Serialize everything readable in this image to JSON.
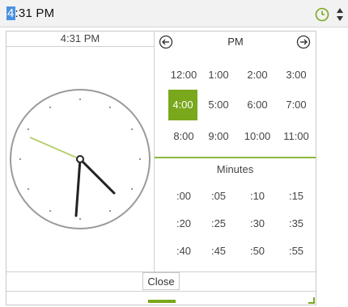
{
  "input": {
    "first_char": "4",
    "rest": ":31 PM"
  },
  "icons": {
    "clock": "clock-icon",
    "spin": "spin-arrows-icon",
    "prev": "arrow-left-circle-icon",
    "next": "arrow-right-circle-icon"
  },
  "analog": {
    "time_label": "4:31 PM"
  },
  "picker": {
    "period_label": "PM",
    "hours": [
      "12:00",
      "1:00",
      "2:00",
      "3:00",
      "4:00",
      "5:00",
      "6:00",
      "7:00",
      "8:00",
      "9:00",
      "10:00",
      "11:00"
    ],
    "selected_hour": "4:00",
    "minutes_title": "Minutes",
    "minutes": [
      ":00",
      ":05",
      ":10",
      ":15",
      ":20",
      ":25",
      ":30",
      ":35",
      ":40",
      ":45",
      ":50",
      ":55"
    ]
  },
  "close_label": "Close",
  "colors": {
    "accent": "#7aa81c",
    "selection": "#4a90e2"
  }
}
